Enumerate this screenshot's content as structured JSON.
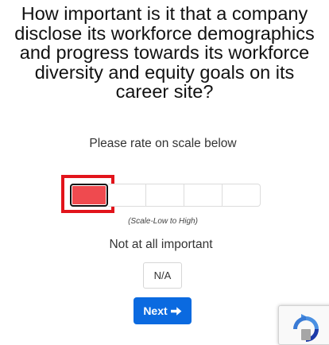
{
  "question": {
    "lines": [
      "How important is it that a company",
      "disclose its workforce demographics",
      "and progress towards its workforce",
      "diversity and equity goals on its",
      "career site?"
    ]
  },
  "instruction": "Please rate on scale below",
  "rating_scale": {
    "points": 5,
    "selected_index": 1,
    "caption": "(Scale-Low to High)",
    "selected_label": "Not at all important",
    "selected_color": "#ef4a4f",
    "highlight_color": "#e2141b"
  },
  "na_button": {
    "label": "N/A"
  },
  "next_button": {
    "label": "Next",
    "icon": "arrow-right-icon",
    "color": "#0b6ae0"
  },
  "recaptcha_badge": {
    "icon": "recaptcha-icon"
  }
}
